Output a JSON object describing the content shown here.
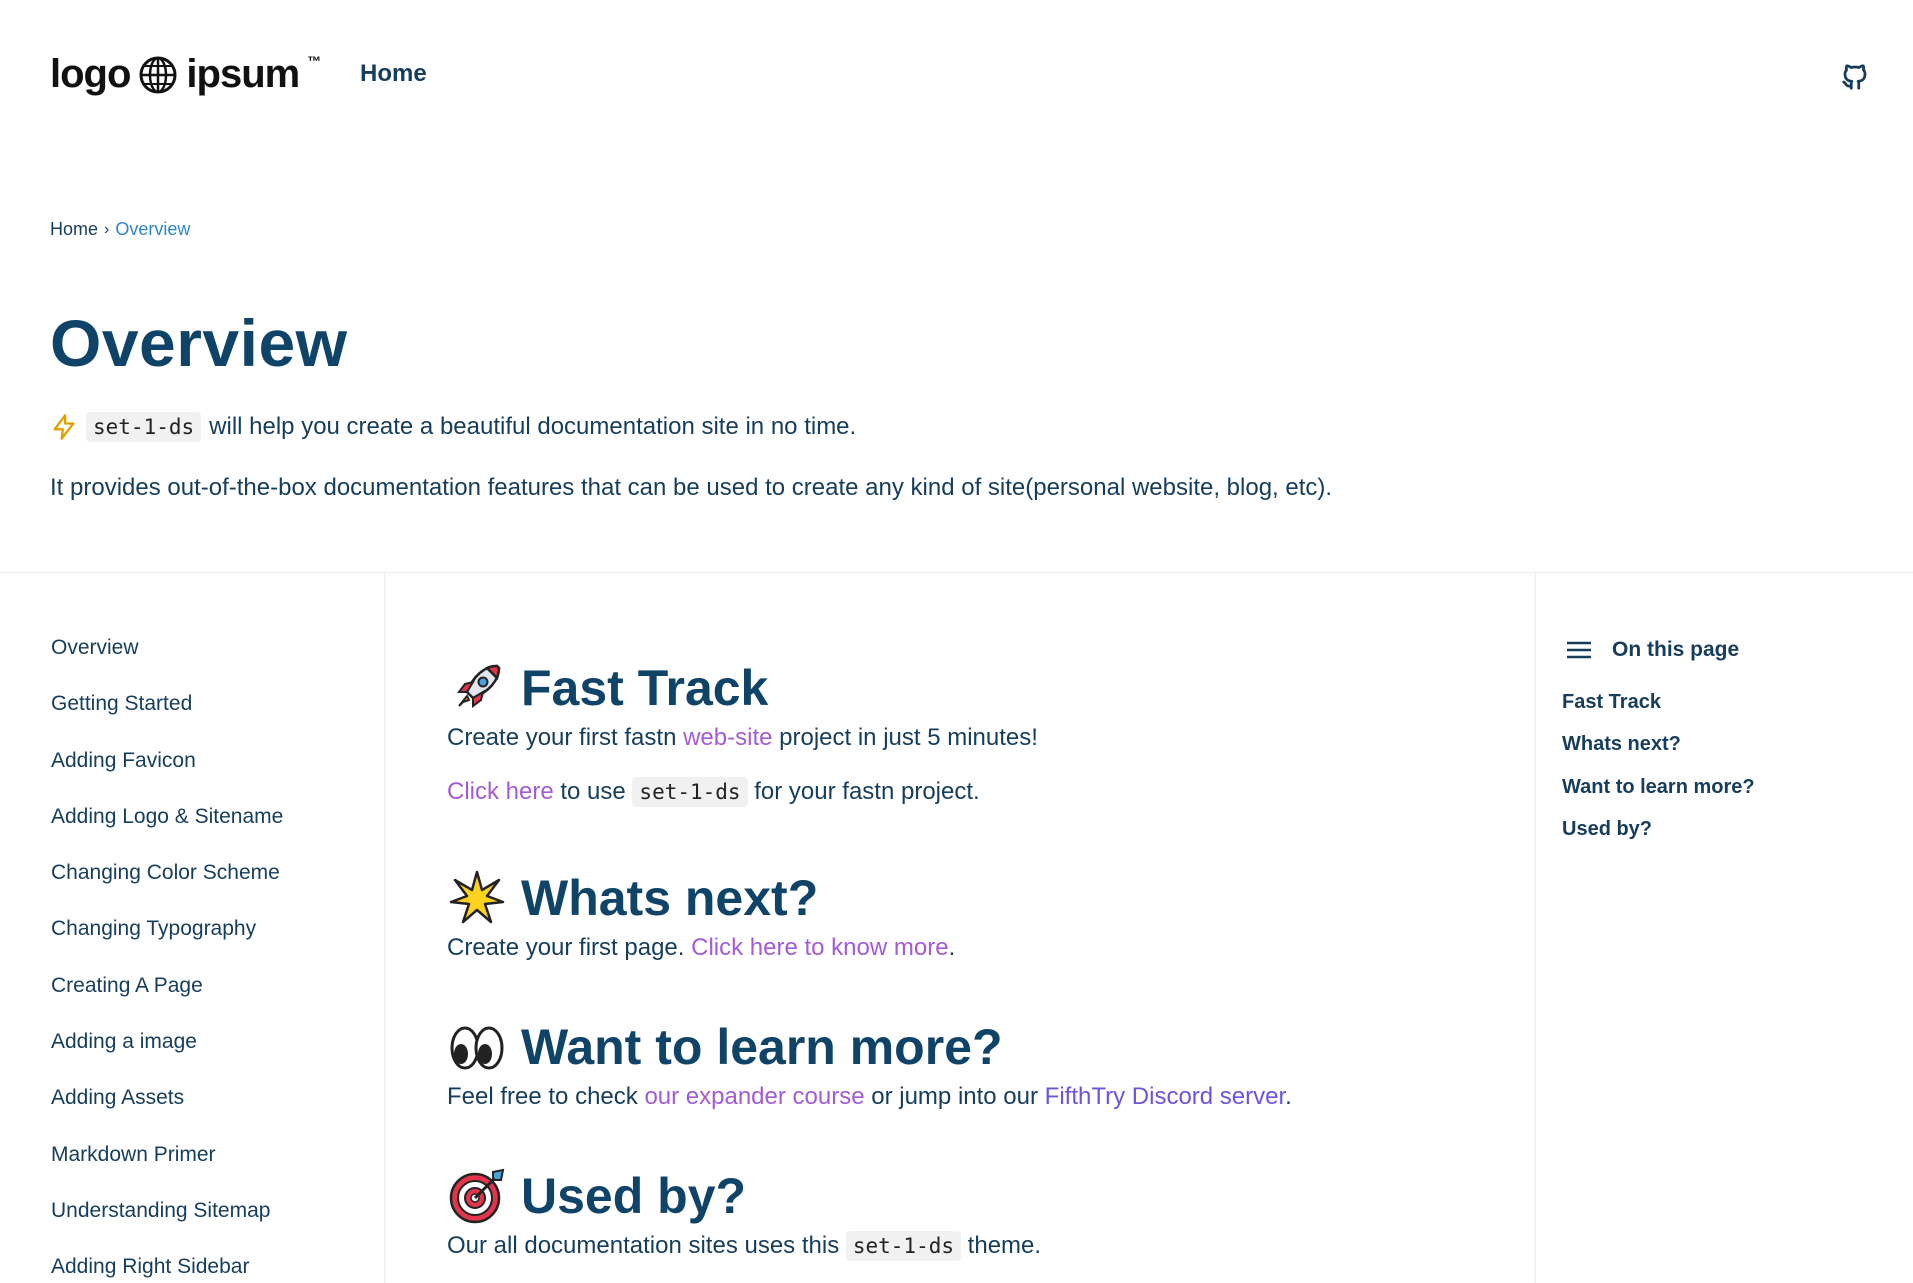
{
  "header": {
    "logo_left": "logo",
    "logo_right": "ipsum",
    "logo_tm": "™",
    "nav_home": "Home"
  },
  "breadcrumb": {
    "home": "Home",
    "separator": "›",
    "current": "Overview"
  },
  "page": {
    "title": "Overview",
    "intro_code": "set-1-ds",
    "intro_text": "will help you create a beautiful documentation site in no time.",
    "intro2": "It provides out-of-the-box documentation features that can be used to create any kind of site(personal website, blog, etc)."
  },
  "left_sidebar": {
    "items": [
      "Overview",
      "Getting Started",
      "Adding Favicon",
      "Adding Logo & Sitename",
      "Changing Color Scheme",
      "Changing Typography",
      "Creating A Page",
      "Adding a image",
      "Adding Assets",
      "Markdown Primer",
      "Understanding Sitemap",
      "Adding Right Sidebar"
    ]
  },
  "sections": {
    "fast_track": {
      "title": "Fast Track",
      "p1_before": "Create your first fastn ",
      "p1_link": "web-site",
      "p1_after": " project in just 5 minutes!",
      "p2_link": "Click here",
      "p2_mid": " to use ",
      "p2_code": "set-1-ds",
      "p2_after": " for your fastn project."
    },
    "whats_next": {
      "title": "Whats next?",
      "p_before": "Create your first page. ",
      "p_link": "Click here to know more",
      "p_after": "."
    },
    "learn_more": {
      "title": "Want to learn more?",
      "p_before": "Feel free to check ",
      "p_link1": "our expander course",
      "p_mid": " or jump into our ",
      "p_link2": "FifthTry Discord server",
      "p_after": "."
    },
    "used_by": {
      "title": "Used by?",
      "p_before": "Our all documentation sites uses this ",
      "p_code": "set-1-ds",
      "p_after": " theme."
    }
  },
  "toc": {
    "title": "On this page",
    "items": [
      "Fast Track",
      "Whats next?",
      "Want to learn more?",
      "Used by?"
    ]
  },
  "colors": {
    "heading": "#0f4468",
    "text": "#163d5c",
    "link_purple": "#a35bd6",
    "link_blue": "#6a55e0",
    "breadcrumb_active": "#2f86c8"
  },
  "icons": [
    "globe-icon",
    "github-icon",
    "lightning-icon",
    "rocket-icon",
    "sparkle-icon",
    "eyes-icon",
    "target-icon",
    "menu-icon"
  ]
}
